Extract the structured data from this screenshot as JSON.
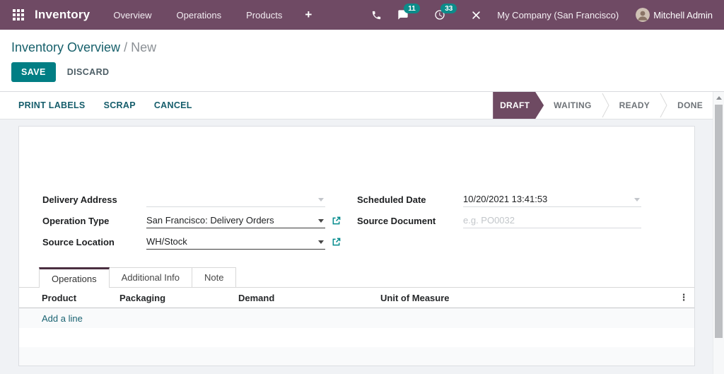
{
  "navbar": {
    "app_name": "Inventory",
    "menu_items": [
      "Overview",
      "Operations",
      "Products"
    ],
    "plus": "+",
    "messages_badge": "11",
    "activities_badge": "33",
    "company": "My Company (San Francisco)",
    "user": "Mitchell Admin"
  },
  "breadcrumb": {
    "parent": "Inventory Overview",
    "separator": "/",
    "current": "New"
  },
  "actions": {
    "save": "SAVE",
    "discard": "DISCARD"
  },
  "toolbar": {
    "print_labels": "PRINT LABELS",
    "scrap": "SCRAP",
    "cancel": "CANCEL"
  },
  "statusbar": {
    "steps": [
      {
        "label": "DRAFT",
        "active": true
      },
      {
        "label": "WAITING",
        "active": false
      },
      {
        "label": "READY",
        "active": false
      },
      {
        "label": "DONE",
        "active": false
      }
    ]
  },
  "form": {
    "delivery_address": {
      "label": "Delivery Address",
      "value": ""
    },
    "operation_type": {
      "label": "Operation Type",
      "value": "San Francisco: Delivery Orders"
    },
    "source_location": {
      "label": "Source Location",
      "value": "WH/Stock"
    },
    "scheduled_date": {
      "label": "Scheduled Date",
      "value": "10/20/2021 13:41:53"
    },
    "source_document": {
      "label": "Source Document",
      "placeholder": "e.g. PO0032"
    }
  },
  "tabs": [
    {
      "label": "Operations",
      "active": true
    },
    {
      "label": "Additional Info",
      "active": false
    },
    {
      "label": "Note",
      "active": false
    }
  ],
  "lines_table": {
    "columns": [
      "Product",
      "Packaging",
      "Demand",
      "Unit of Measure"
    ],
    "add_line_label": "Add a line",
    "options_icon": "⋮"
  },
  "colors": {
    "brand_purple": "#6F4A64",
    "primary_teal": "#017E84",
    "badge_teal": "#0C8C8A",
    "link_teal": "#17606B",
    "active_step_purple": "#6E4A62"
  }
}
